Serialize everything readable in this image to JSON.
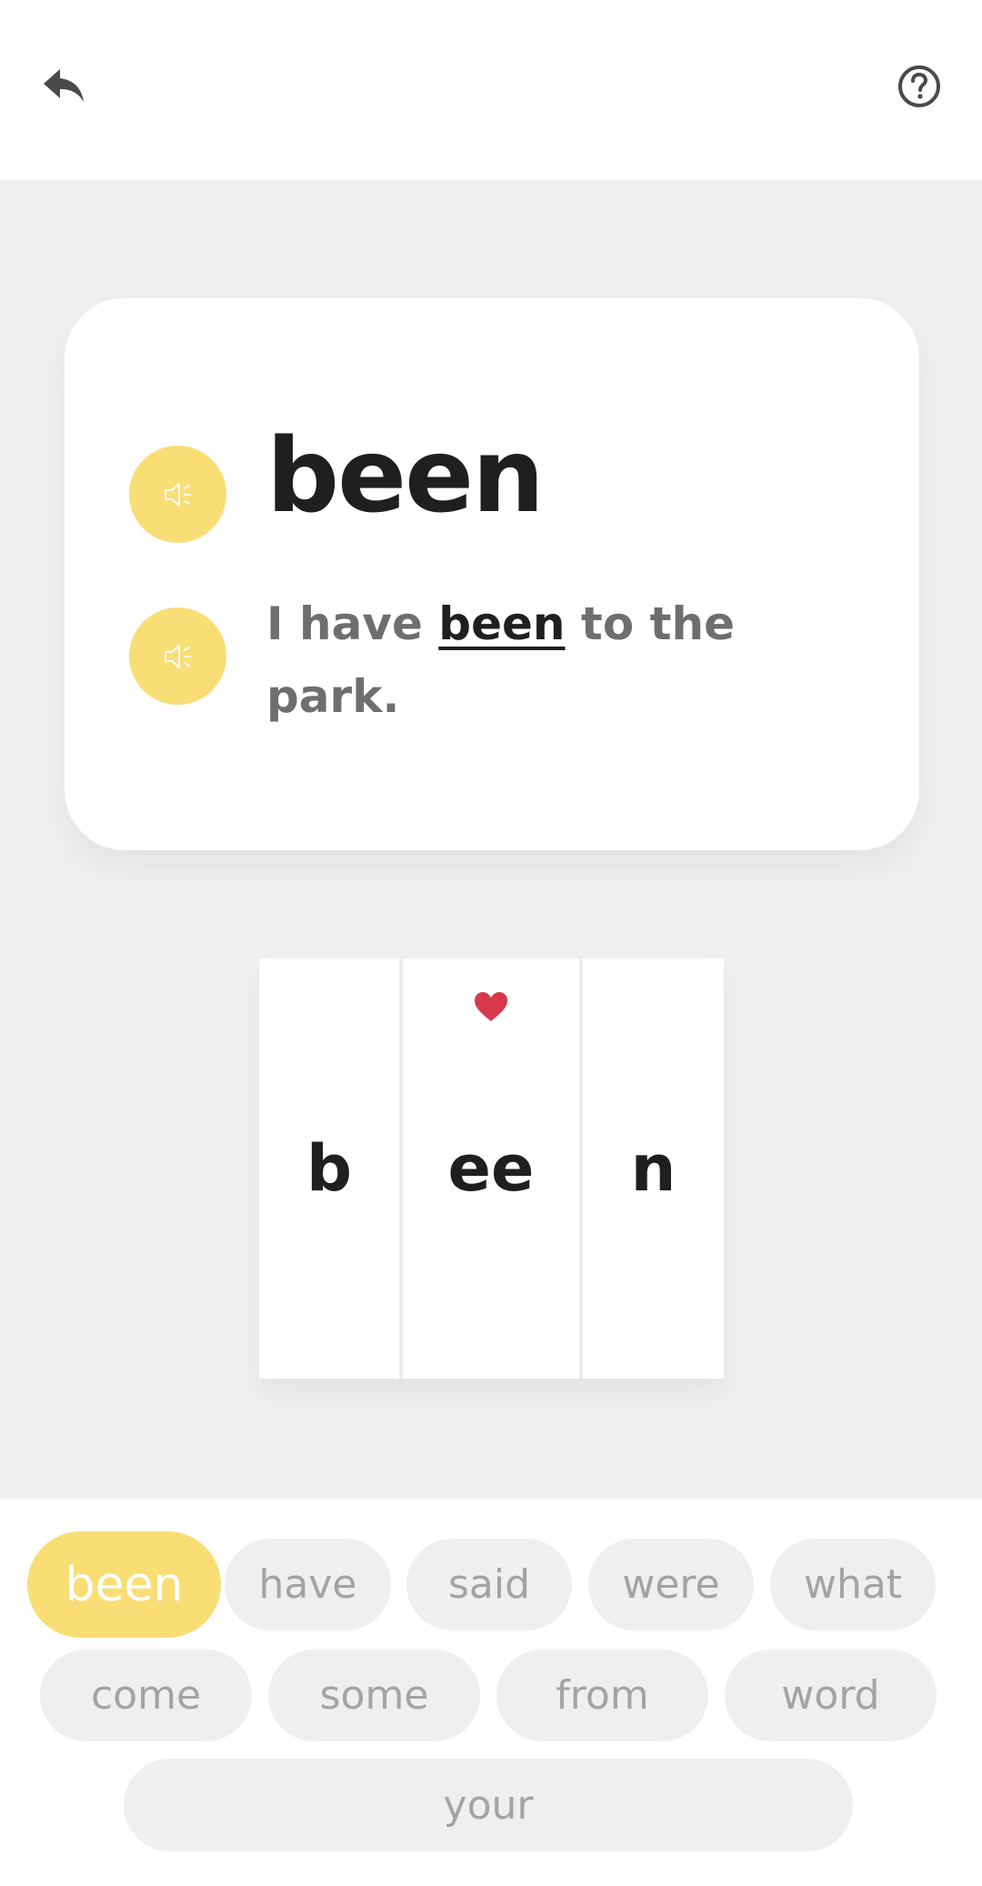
{
  "header": {
    "back_icon": "reply-arrow-icon",
    "help_icon": "question-circle-icon"
  },
  "card": {
    "word": "been",
    "sentence_before": "I have",
    "sentence_highlight": "been",
    "sentence_after": "to the park.",
    "speaker_icon": "speaker-icon"
  },
  "tiles": {
    "letters": [
      "b",
      "ee",
      "n"
    ],
    "heart_icon": "heart-icon",
    "heart_color": "#d63a4a"
  },
  "word_list": {
    "selected": "been",
    "words": [
      "been",
      "have",
      "said",
      "were",
      "what",
      "come",
      "some",
      "from",
      "word",
      "your"
    ]
  },
  "colors": {
    "accent": "#f9de76",
    "chip_bg": "#efefef",
    "chip_text": "#a3a3a3"
  }
}
